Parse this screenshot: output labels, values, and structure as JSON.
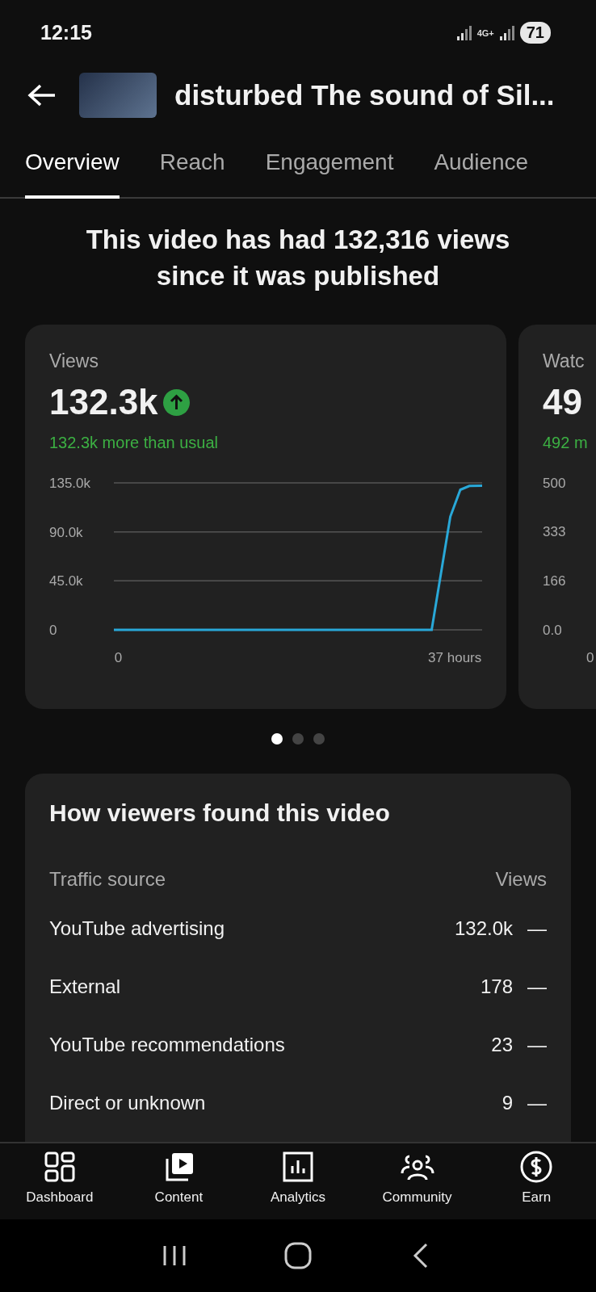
{
  "status_bar": {
    "time": "12:15",
    "network": "4G+",
    "battery": "71"
  },
  "header": {
    "title": "disturbed The sound of Sil..."
  },
  "tabs": [
    {
      "label": "Overview",
      "selected": true
    },
    {
      "label": "Reach",
      "selected": false
    },
    {
      "label": "Engagement",
      "selected": false
    },
    {
      "label": "Audience",
      "selected": false
    }
  ],
  "headline": "This video has had 132,316 views since it was published",
  "metric_cards": [
    {
      "kind": "full",
      "title": "Views",
      "value": "132.3k",
      "rising": true,
      "comparison": "132.3k more than usual",
      "chart_data": {
        "type": "line",
        "x": [
          -0.5,
          34.45,
          36.5,
          37.6,
          38.6,
          40
        ],
        "series": [
          {
            "color": "#29a8d8",
            "values": [
              0,
              0,
              104000,
              128700,
              132200,
              132300
            ]
          }
        ],
        "xlim": [
          -0.5,
          40
        ],
        "ylim": [
          0,
          135000
        ],
        "xticks": [
          {
            "value": 0,
            "label": "0"
          },
          {
            "value": 37,
            "label": "37 hours"
          }
        ],
        "yticks": [
          {
            "value": 0,
            "label": "0"
          },
          {
            "value": 45000,
            "label": "45.0k"
          },
          {
            "value": 90000,
            "label": "90.0k"
          },
          {
            "value": 135000,
            "label": "135.0k"
          }
        ]
      }
    },
    {
      "kind": "partial",
      "title": "Watc",
      "value": "49",
      "comparison": "492 m",
      "axis_labels": [
        "500",
        "333",
        "166",
        "0.0"
      ],
      "x_label": "0"
    }
  ],
  "pager": [
    {
      "selected": true
    },
    {
      "selected": false
    },
    {
      "selected": false
    }
  ],
  "traffic": {
    "title": "How viewers found this video",
    "columns": [
      "Traffic source",
      "Views"
    ],
    "rows": [
      {
        "source": "YouTube advertising",
        "views": "132.0k",
        "trend": "—"
      },
      {
        "source": "External",
        "views": "178",
        "trend": "—"
      },
      {
        "source": "YouTube recommendations",
        "views": "23",
        "trend": "—"
      },
      {
        "source": "Direct or unknown",
        "views": "9",
        "trend": "—"
      }
    ]
  },
  "bottom_nav": [
    {
      "kind": "dashboard",
      "label": "Dashboard"
    },
    {
      "kind": "content",
      "label": "Content"
    },
    {
      "kind": "analytics",
      "label": "Analytics"
    },
    {
      "kind": "community",
      "label": "Community"
    },
    {
      "kind": "earn",
      "label": "Earn"
    }
  ]
}
